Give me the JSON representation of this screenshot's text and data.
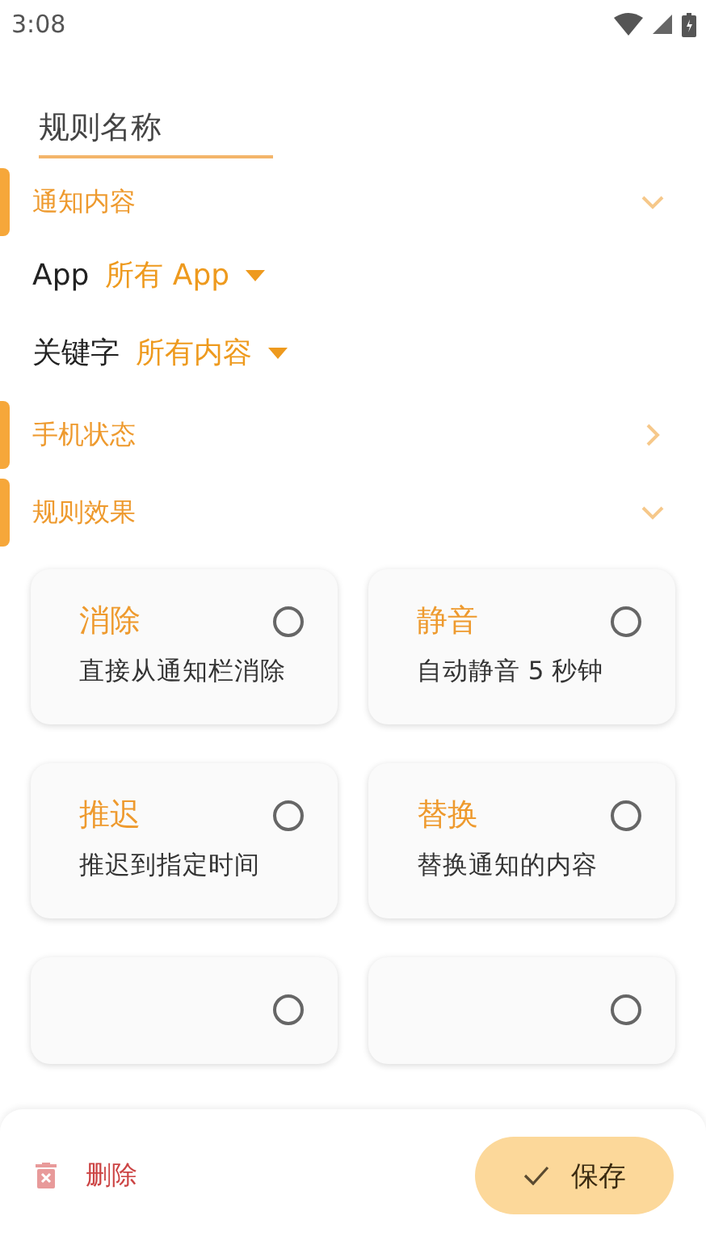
{
  "status_bar": {
    "time": "3:08"
  },
  "name_field": {
    "placeholder": "规则名称"
  },
  "sections": [
    {
      "title": "通知内容",
      "expanded": true,
      "filters": [
        {
          "label": "App",
          "value": "所有 App"
        },
        {
          "label": "关键字",
          "value": "所有内容"
        }
      ]
    },
    {
      "title": "手机状态",
      "expanded": false
    },
    {
      "title": "规则效果",
      "expanded": true,
      "effects": [
        {
          "title": "消除",
          "description": "直接从通知栏消除",
          "selected": false
        },
        {
          "title": "静音",
          "description": "自动静音 5 秒钟",
          "selected": false
        },
        {
          "title": "推迟",
          "description": "推迟到指定时间",
          "selected": false
        },
        {
          "title": "替换",
          "description": "替换通知的内容",
          "selected": false
        },
        {
          "selected": false
        },
        {
          "selected": false
        }
      ]
    }
  ],
  "actions": {
    "delete": "删除",
    "save": "保存"
  }
}
